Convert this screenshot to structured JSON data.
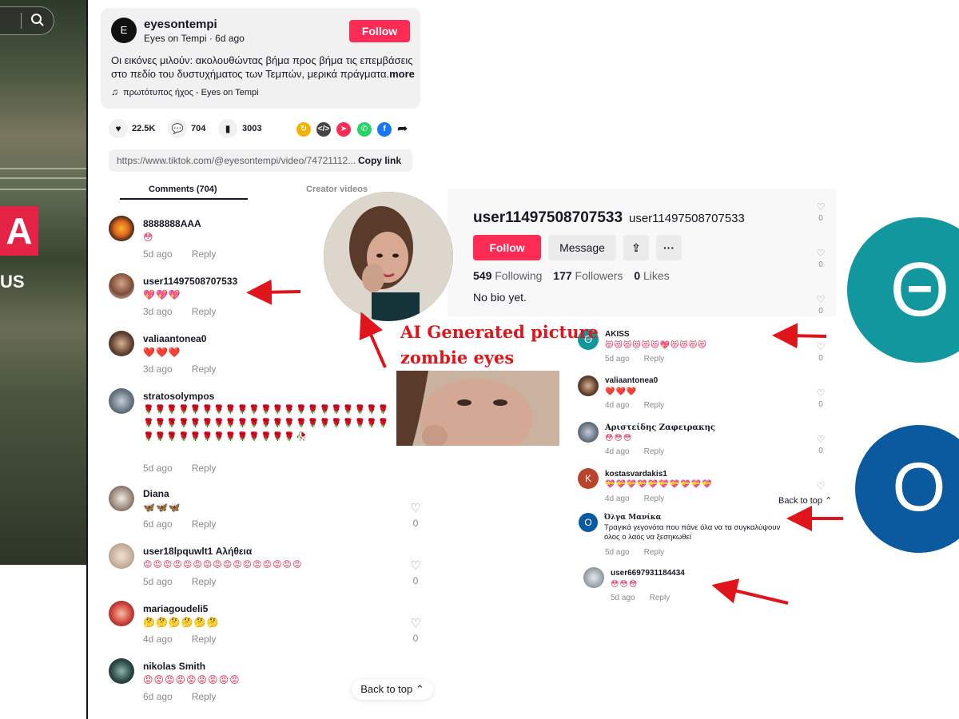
{
  "post": {
    "author": "eyesontempi",
    "author_sub": "Eyes on Tempi · 6d ago",
    "follow_label": "Follow",
    "description": "Οι εικόνες μιλούν: ακολουθώντας βήμα προς βήμα τις επεμβάσεις στο πεδίο του δυστυχήματος των Τεμπών, μερικά πράγματα.",
    "more_label": "more",
    "sound": "πρωτότυπος ήχος - Eyes on Tempi",
    "likes": "22.5K",
    "comments": "704",
    "saves": "3003",
    "url": "https://www.tiktok.com/@eyesontempi/video/74721112...",
    "copy_label": "Copy link",
    "tab_comments": "Comments (704)",
    "tab_creator": "Creator videos"
  },
  "comments": [
    {
      "name": "8888888AAA",
      "text": "😳",
      "date": "5d ago",
      "reply": "Reply"
    },
    {
      "name": "user11497508707533",
      "text": "💖💖💖",
      "date": "3d ago",
      "reply": "Reply"
    },
    {
      "name": "valiaantonea0",
      "text": "❤️❤️❤️",
      "date": "3d ago",
      "reply": "Reply"
    },
    {
      "name": "stratosolympos",
      "text": "🌹🌹🌹🌹🌹🌹🌹🌹🌹🌹🌹🌹🌹🌹🌹🌹🌹🌹🌹🌹🌹🌹🌹🌹🌹🌹🌹🌹🌹🌹🌹🌹🌹🌹🌹🌹🌹🌹🌹🌹🌹🌹🌹🌹🌹🌹🌹🌹🌹🌹🌹🌹🌹🌹🌹🥀",
      "date": "5d ago",
      "reply": "Reply"
    },
    {
      "name": "Diana",
      "text": "🦋🦋🦋",
      "date": "6d ago",
      "reply": "Reply",
      "likes": "0"
    },
    {
      "name": "user18lpquwlt1 Αλήθεια",
      "text": "😡😡😡😡😡😡😡😡😡😡😡😡😡😡😡😡",
      "date": "5d ago",
      "reply": "Reply",
      "likes": "0"
    },
    {
      "name": "mariagoudeli5",
      "text": "🤔🤔🤔🤔🤔🤔",
      "date": "4d ago",
      "reply": "Reply",
      "likes": "0"
    },
    {
      "name": "nikolas Smith",
      "text": "😡😡😡😡😡😡😡😡😡",
      "date": "6d ago",
      "reply": "Reply"
    }
  ],
  "back_to_top": "Back to top",
  "profile": {
    "username": "user11497508707533",
    "handle": "user11497508707533",
    "follow_label": "Follow",
    "message_label": "Message",
    "following_count": "549",
    "following_label": "Following",
    "followers_count": "177",
    "followers_label": "Followers",
    "likes_count": "0",
    "likes_label": "Likes",
    "bio": "No bio yet."
  },
  "right_comments": [
    {
      "name": "AKISS",
      "text": "😻😻😻😻😻😻💖😻😻😻😻",
      "date": "5d ago",
      "reply": "Reply",
      "likes": "0"
    },
    {
      "name": "valiaantonea0",
      "text": "❤️❤️❤️",
      "date": "4d ago",
      "reply": "Reply",
      "likes": "0"
    },
    {
      "name": "Αριστείδης Ζαφειρακης",
      "text": "😳😳😳",
      "date": "4d ago",
      "reply": "Reply",
      "likes": "0"
    },
    {
      "name": "kostasvardakis1",
      "text": "💝💝💝💝💝💝💝💝💝💝",
      "date": "4d ago",
      "reply": "Reply"
    },
    {
      "name": "Όλγα Μανίκα",
      "text": "Τραγικά γεγονότα που πάνε όλα να τα συγκαλύψουν όλος ο λαός να ξεσηκωθεί",
      "date": "5d ago",
      "reply": "Reply"
    },
    {
      "name": "user6697931184434",
      "text": "😳😳😳",
      "date": "5d ago",
      "reply": "Reply"
    }
  ],
  "right_like_counts": [
    "0",
    "0",
    "0",
    "0",
    "0"
  ],
  "annotation": {
    "line1": "AI Generated picture",
    "line2": "zombie eyes"
  },
  "letters": {
    "theta": "Θ",
    "omicron": "Ο",
    "akiss_avatar": "Θ",
    "olga_avatar": "Ο",
    "kostas_avatar": "K"
  },
  "colors": {
    "brand": "#fe2c55",
    "arrow": "#e0151b",
    "theta_bg": "#13979f",
    "omicron_bg": "#0b5aa0"
  }
}
